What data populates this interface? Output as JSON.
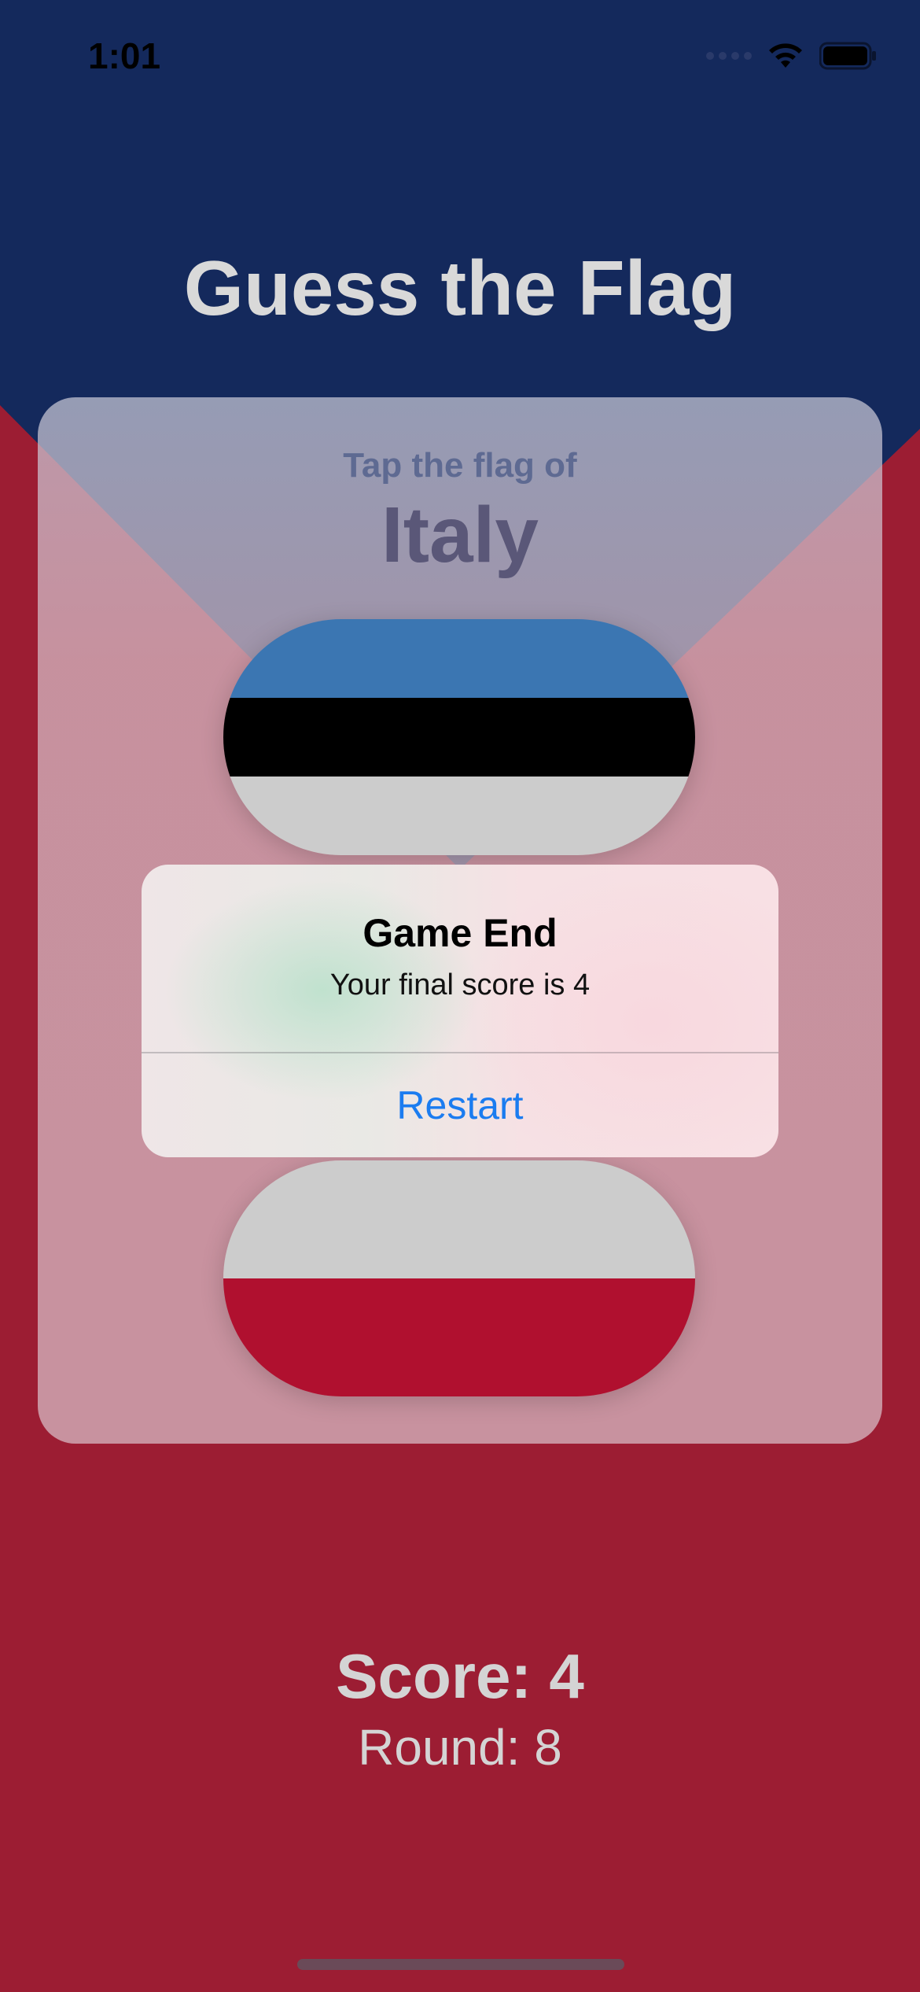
{
  "status_bar": {
    "time": "1:01"
  },
  "app": {
    "title": "Guess the Flag"
  },
  "question": {
    "prompt": "Tap the flag of",
    "country": "Italy"
  },
  "flags": [
    {
      "name": "estonia-flag",
      "stripes": [
        "#3b76b2",
        "#000000",
        "#cccccc"
      ]
    },
    {
      "name": "poland-flag",
      "stripes": [
        "#cccccc",
        "#b0102f"
      ]
    }
  ],
  "alert": {
    "title": "Game End",
    "message": "Your final score is 4",
    "button": "Restart"
  },
  "footer": {
    "score": "Score: 4",
    "round": "Round: 8"
  },
  "colors": {
    "top_background": "#14295c",
    "bottom_background": "#9c1d33",
    "button_blue": "#1b7cf0"
  }
}
